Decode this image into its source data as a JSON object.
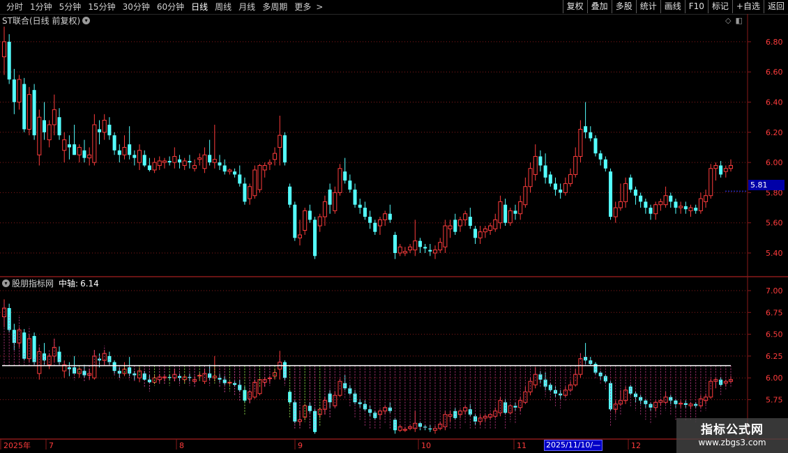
{
  "toolbar": {
    "tabs": [
      "分时",
      "1分钟",
      "5分钟",
      "15分钟",
      "30分钟",
      "60分钟",
      "日线",
      "周线",
      "月线",
      "多周期",
      "更多"
    ],
    "active_tab": "日线",
    "right_buttons": [
      "复权",
      "叠加",
      "多股",
      "统计",
      "画线",
      "F10",
      "标记",
      "+自选",
      "返回"
    ]
  },
  "main_panel": {
    "title": "ST联合(日线 前复权)",
    "price_ticks": [
      "6.80",
      "6.60",
      "6.40",
      "6.20",
      "6.00",
      "5.80",
      "5.60",
      "5.40"
    ],
    "current_price": "5.81"
  },
  "indicator_panel": {
    "name": "股朋指标网",
    "param_label": "中轴:",
    "param_value": "6.14",
    "ticks": [
      "7.00",
      "6.75",
      "6.50",
      "6.25",
      "6.00",
      "5.75"
    ]
  },
  "time_axis": {
    "labels": [
      "2025年",
      "7",
      "8",
      "9",
      "10",
      "11",
      "12"
    ],
    "cursor_date": "2025/11/10/—"
  },
  "watermark": {
    "line1": "指标公式网",
    "line2": "www.zbgs3.com"
  },
  "colors": {
    "up": "#ff3c3c",
    "down": "#54ffff",
    "grid": "#8a1a1a",
    "axis_text": "#ff3c3c",
    "pivot_line": "#ffffff"
  },
  "chart_data": {
    "type": "candlestick",
    "series": [
      {
        "o": 6.7,
        "h": 6.9,
        "l": 6.58,
        "c": 6.8
      },
      {
        "o": 6.8,
        "h": 6.85,
        "l": 6.52,
        "c": 6.55
      },
      {
        "o": 6.55,
        "h": 6.62,
        "l": 6.32,
        "c": 6.4
      },
      {
        "o": 6.4,
        "h": 6.58,
        "l": 6.35,
        "c": 6.55
      },
      {
        "o": 6.52,
        "h": 6.56,
        "l": 6.2,
        "c": 6.22
      },
      {
        "o": 6.22,
        "h": 6.5,
        "l": 6.18,
        "c": 6.45
      },
      {
        "o": 6.48,
        "h": 6.52,
        "l": 6.15,
        "c": 6.18
      },
      {
        "o": 6.05,
        "h": 6.35,
        "l": 5.98,
        "c": 6.3
      },
      {
        "o": 6.28,
        "h": 6.4,
        "l": 6.15,
        "c": 6.2
      },
      {
        "o": 6.15,
        "h": 6.28,
        "l": 6.1,
        "c": 6.25
      },
      {
        "o": 6.25,
        "h": 6.45,
        "l": 6.18,
        "c": 6.35
      },
      {
        "o": 6.3,
        "h": 6.36,
        "l": 6.15,
        "c": 6.18
      },
      {
        "o": 6.08,
        "h": 6.2,
        "l": 6.0,
        "c": 6.15
      },
      {
        "o": 6.12,
        "h": 6.18,
        "l": 6.02,
        "c": 6.1
      },
      {
        "o": 6.12,
        "h": 6.25,
        "l": 6.05,
        "c": 6.05
      },
      {
        "o": 6.05,
        "h": 6.12,
        "l": 6.0,
        "c": 6.1
      },
      {
        "o": 6.08,
        "h": 6.15,
        "l": 6.0,
        "c": 6.03
      },
      {
        "o": 6.03,
        "h": 6.1,
        "l": 5.98,
        "c": 6.05
      },
      {
        "o": 6.0,
        "h": 6.32,
        "l": 5.98,
        "c": 6.25
      },
      {
        "o": 6.22,
        "h": 6.28,
        "l": 6.12,
        "c": 6.2
      },
      {
        "o": 6.2,
        "h": 6.32,
        "l": 6.15,
        "c": 6.28
      },
      {
        "o": 6.25,
        "h": 6.3,
        "l": 6.15,
        "c": 6.18
      },
      {
        "o": 6.18,
        "h": 6.2,
        "l": 6.05,
        "c": 6.08
      },
      {
        "o": 6.08,
        "h": 6.12,
        "l": 6.0,
        "c": 6.05
      },
      {
        "o": 6.05,
        "h": 6.18,
        "l": 6.02,
        "c": 6.1
      },
      {
        "o": 6.12,
        "h": 6.24,
        "l": 6.02,
        "c": 6.05
      },
      {
        "o": 6.05,
        "h": 6.08,
        "l": 5.98,
        "c": 6.03
      },
      {
        "o": 6.0,
        "h": 6.12,
        "l": 5.95,
        "c": 6.08
      },
      {
        "o": 6.05,
        "h": 6.08,
        "l": 5.97,
        "c": 5.98
      },
      {
        "o": 5.98,
        "h": 6.03,
        "l": 5.94,
        "c": 5.95
      },
      {
        "o": 5.95,
        "h": 6.03,
        "l": 5.93,
        "c": 6.0
      },
      {
        "o": 5.98,
        "h": 6.04,
        "l": 5.95,
        "c": 6.01
      },
      {
        "o": 6.0,
        "h": 6.03,
        "l": 5.96,
        "c": 6.01
      },
      {
        "o": 6.01,
        "h": 6.04,
        "l": 5.98,
        "c": 6.0
      },
      {
        "o": 6.0,
        "h": 6.1,
        "l": 5.96,
        "c": 6.04
      },
      {
        "o": 6.02,
        "h": 6.05,
        "l": 5.96,
        "c": 6.0
      },
      {
        "o": 5.98,
        "h": 6.03,
        "l": 5.95,
        "c": 6.01
      },
      {
        "o": 6.01,
        "h": 6.05,
        "l": 5.96,
        "c": 6.0
      },
      {
        "o": 5.96,
        "h": 6.02,
        "l": 5.94,
        "c": 5.98
      },
      {
        "o": 6.02,
        "h": 6.06,
        "l": 5.98,
        "c": 6.03
      },
      {
        "o": 5.96,
        "h": 6.1,
        "l": 5.93,
        "c": 6.05
      },
      {
        "o": 6.05,
        "h": 6.15,
        "l": 5.98,
        "c": 6.0
      },
      {
        "o": 6.0,
        "h": 6.25,
        "l": 5.96,
        "c": 6.02
      },
      {
        "o": 6.0,
        "h": 6.05,
        "l": 5.95,
        "c": 5.98
      },
      {
        "o": 5.98,
        "h": 6.02,
        "l": 5.92,
        "c": 5.94
      },
      {
        "o": 5.94,
        "h": 5.96,
        "l": 5.92,
        "c": 5.95
      },
      {
        "o": 5.94,
        "h": 5.96,
        "l": 5.9,
        "c": 5.92
      },
      {
        "o": 5.92,
        "h": 5.98,
        "l": 5.84,
        "c": 5.86
      },
      {
        "o": 5.86,
        "h": 5.9,
        "l": 5.72,
        "c": 5.74
      },
      {
        "o": 5.76,
        "h": 5.86,
        "l": 5.72,
        "c": 5.84
      },
      {
        "o": 5.78,
        "h": 5.98,
        "l": 5.76,
        "c": 5.95
      },
      {
        "o": 5.82,
        "h": 5.99,
        "l": 5.8,
        "c": 5.98
      },
      {
        "o": 5.95,
        "h": 6.0,
        "l": 5.9,
        "c": 5.98
      },
      {
        "o": 5.99,
        "h": 6.02,
        "l": 5.95,
        "c": 6.0
      },
      {
        "o": 6.02,
        "h": 6.1,
        "l": 5.98,
        "c": 6.06
      },
      {
        "o": 6.1,
        "h": 6.31,
        "l": 5.98,
        "c": 6.18
      },
      {
        "o": 6.18,
        "h": 6.2,
        "l": 5.98,
        "c": 6.0
      },
      {
        "o": 5.84,
        "h": 5.86,
        "l": 5.7,
        "c": 5.72
      },
      {
        "o": 5.72,
        "h": 5.74,
        "l": 5.48,
        "c": 5.5
      },
      {
        "o": 5.5,
        "h": 5.62,
        "l": 5.45,
        "c": 5.52
      },
      {
        "o": 5.55,
        "h": 5.7,
        "l": 5.52,
        "c": 5.68
      },
      {
        "o": 5.68,
        "h": 5.72,
        "l": 5.6,
        "c": 5.62
      },
      {
        "o": 5.62,
        "h": 5.64,
        "l": 5.36,
        "c": 5.38
      },
      {
        "o": 5.58,
        "h": 5.66,
        "l": 5.54,
        "c": 5.64
      },
      {
        "o": 5.64,
        "h": 5.78,
        "l": 5.58,
        "c": 5.74
      },
      {
        "o": 5.82,
        "h": 5.86,
        "l": 5.66,
        "c": 5.72
      },
      {
        "o": 5.68,
        "h": 5.84,
        "l": 5.66,
        "c": 5.8
      },
      {
        "o": 5.8,
        "h": 5.99,
        "l": 5.78,
        "c": 5.96
      },
      {
        "o": 5.94,
        "h": 6.03,
        "l": 5.86,
        "c": 5.88
      },
      {
        "o": 5.88,
        "h": 5.92,
        "l": 5.8,
        "c": 5.82
      },
      {
        "o": 5.82,
        "h": 5.86,
        "l": 5.7,
        "c": 5.72
      },
      {
        "o": 5.72,
        "h": 5.76,
        "l": 5.66,
        "c": 5.7
      },
      {
        "o": 5.7,
        "h": 5.74,
        "l": 5.62,
        "c": 5.64
      },
      {
        "o": 5.64,
        "h": 5.68,
        "l": 5.56,
        "c": 5.6
      },
      {
        "o": 5.6,
        "h": 5.62,
        "l": 5.52,
        "c": 5.54
      },
      {
        "o": 5.58,
        "h": 5.64,
        "l": 5.52,
        "c": 5.62
      },
      {
        "o": 5.62,
        "h": 5.68,
        "l": 5.58,
        "c": 5.66
      },
      {
        "o": 5.66,
        "h": 5.72,
        "l": 5.6,
        "c": 5.62
      },
      {
        "o": 5.52,
        "h": 5.54,
        "l": 5.36,
        "c": 5.4
      },
      {
        "o": 5.4,
        "h": 5.46,
        "l": 5.38,
        "c": 5.44
      },
      {
        "o": 5.4,
        "h": 5.44,
        "l": 5.38,
        "c": 5.41
      },
      {
        "o": 5.42,
        "h": 5.46,
        "l": 5.4,
        "c": 5.44
      },
      {
        "o": 5.42,
        "h": 5.62,
        "l": 5.38,
        "c": 5.48
      },
      {
        "o": 5.48,
        "h": 5.5,
        "l": 5.4,
        "c": 5.44
      },
      {
        "o": 5.44,
        "h": 5.46,
        "l": 5.4,
        "c": 5.43
      },
      {
        "o": 5.42,
        "h": 5.46,
        "l": 5.38,
        "c": 5.41
      },
      {
        "o": 5.4,
        "h": 5.45,
        "l": 5.36,
        "c": 5.42
      },
      {
        "o": 5.42,
        "h": 5.5,
        "l": 5.4,
        "c": 5.47
      },
      {
        "o": 5.44,
        "h": 5.62,
        "l": 5.4,
        "c": 5.58
      },
      {
        "o": 5.56,
        "h": 5.62,
        "l": 5.5,
        "c": 5.58
      },
      {
        "o": 5.62,
        "h": 5.66,
        "l": 5.52,
        "c": 5.54
      },
      {
        "o": 5.58,
        "h": 5.64,
        "l": 5.54,
        "c": 5.62
      },
      {
        "o": 5.62,
        "h": 5.68,
        "l": 5.58,
        "c": 5.66
      },
      {
        "o": 5.64,
        "h": 5.7,
        "l": 5.56,
        "c": 5.58
      },
      {
        "o": 5.56,
        "h": 5.58,
        "l": 5.46,
        "c": 5.5
      },
      {
        "o": 5.5,
        "h": 5.58,
        "l": 5.46,
        "c": 5.54
      },
      {
        "o": 5.54,
        "h": 5.58,
        "l": 5.5,
        "c": 5.56
      },
      {
        "o": 5.55,
        "h": 5.6,
        "l": 5.52,
        "c": 5.58
      },
      {
        "o": 5.56,
        "h": 5.66,
        "l": 5.54,
        "c": 5.62
      },
      {
        "o": 5.6,
        "h": 5.78,
        "l": 5.56,
        "c": 5.74
      },
      {
        "o": 5.72,
        "h": 5.76,
        "l": 5.58,
        "c": 5.6
      },
      {
        "o": 5.6,
        "h": 5.7,
        "l": 5.58,
        "c": 5.68
      },
      {
        "o": 5.68,
        "h": 5.72,
        "l": 5.62,
        "c": 5.66
      },
      {
        "o": 5.66,
        "h": 5.78,
        "l": 5.62,
        "c": 5.74
      },
      {
        "o": 5.72,
        "h": 5.9,
        "l": 5.7,
        "c": 5.84
      },
      {
        "o": 5.84,
        "h": 6.0,
        "l": 5.8,
        "c": 5.96
      },
      {
        "o": 5.92,
        "h": 6.12,
        "l": 5.88,
        "c": 6.04
      },
      {
        "o": 6.04,
        "h": 6.08,
        "l": 5.94,
        "c": 5.98
      },
      {
        "o": 5.98,
        "h": 6.06,
        "l": 5.86,
        "c": 5.9
      },
      {
        "o": 5.92,
        "h": 5.94,
        "l": 5.84,
        "c": 5.86
      },
      {
        "o": 5.86,
        "h": 5.9,
        "l": 5.78,
        "c": 5.82
      },
      {
        "o": 5.82,
        "h": 5.86,
        "l": 5.76,
        "c": 5.8
      },
      {
        "o": 5.8,
        "h": 5.9,
        "l": 5.78,
        "c": 5.86
      },
      {
        "o": 5.86,
        "h": 5.96,
        "l": 5.84,
        "c": 5.92
      },
      {
        "o": 5.92,
        "h": 6.1,
        "l": 5.9,
        "c": 6.04
      },
      {
        "o": 6.04,
        "h": 6.28,
        "l": 6.0,
        "c": 6.22
      },
      {
        "o": 6.24,
        "h": 6.4,
        "l": 6.16,
        "c": 6.2
      },
      {
        "o": 6.2,
        "h": 6.24,
        "l": 6.14,
        "c": 6.16
      },
      {
        "o": 6.16,
        "h": 6.18,
        "l": 6.04,
        "c": 6.06
      },
      {
        "o": 6.06,
        "h": 6.08,
        "l": 5.98,
        "c": 6.02
      },
      {
        "o": 6.02,
        "h": 6.04,
        "l": 5.94,
        "c": 5.96
      },
      {
        "o": 5.94,
        "h": 5.96,
        "l": 5.62,
        "c": 5.64
      },
      {
        "o": 5.64,
        "h": 5.74,
        "l": 5.6,
        "c": 5.7
      },
      {
        "o": 5.7,
        "h": 5.86,
        "l": 5.68,
        "c": 5.74
      },
      {
        "o": 5.74,
        "h": 5.9,
        "l": 5.7,
        "c": 5.86
      },
      {
        "o": 5.9,
        "h": 5.92,
        "l": 5.8,
        "c": 5.82
      },
      {
        "o": 5.82,
        "h": 5.84,
        "l": 5.72,
        "c": 5.78
      },
      {
        "o": 5.78,
        "h": 5.8,
        "l": 5.7,
        "c": 5.74
      },
      {
        "o": 5.74,
        "h": 5.76,
        "l": 5.66,
        "c": 5.7
      },
      {
        "o": 5.7,
        "h": 5.72,
        "l": 5.62,
        "c": 5.66
      },
      {
        "o": 5.66,
        "h": 5.74,
        "l": 5.62,
        "c": 5.72
      },
      {
        "o": 5.72,
        "h": 5.76,
        "l": 5.68,
        "c": 5.74
      },
      {
        "o": 5.72,
        "h": 5.84,
        "l": 5.7,
        "c": 5.78
      },
      {
        "o": 5.78,
        "h": 5.8,
        "l": 5.7,
        "c": 5.74
      },
      {
        "o": 5.74,
        "h": 5.76,
        "l": 5.66,
        "c": 5.7
      },
      {
        "o": 5.7,
        "h": 5.74,
        "l": 5.66,
        "c": 5.71
      },
      {
        "o": 5.71,
        "h": 5.74,
        "l": 5.66,
        "c": 5.69
      },
      {
        "o": 5.68,
        "h": 5.72,
        "l": 5.64,
        "c": 5.7
      },
      {
        "o": 5.7,
        "h": 5.72,
        "l": 5.66,
        "c": 5.68
      },
      {
        "o": 5.68,
        "h": 5.8,
        "l": 5.66,
        "c": 5.76
      },
      {
        "o": 5.74,
        "h": 5.82,
        "l": 5.7,
        "c": 5.78
      },
      {
        "o": 5.78,
        "h": 5.99,
        "l": 5.76,
        "c": 5.96
      },
      {
        "o": 5.96,
        "h": 6.0,
        "l": 5.88,
        "c": 5.98
      },
      {
        "o": 5.98,
        "h": 6.01,
        "l": 5.9,
        "c": 5.92
      },
      {
        "o": 5.94,
        "h": 5.98,
        "l": 5.9,
        "c": 5.96
      },
      {
        "o": 5.96,
        "h": 6.02,
        "l": 5.94,
        "c": 5.98
      }
    ]
  }
}
